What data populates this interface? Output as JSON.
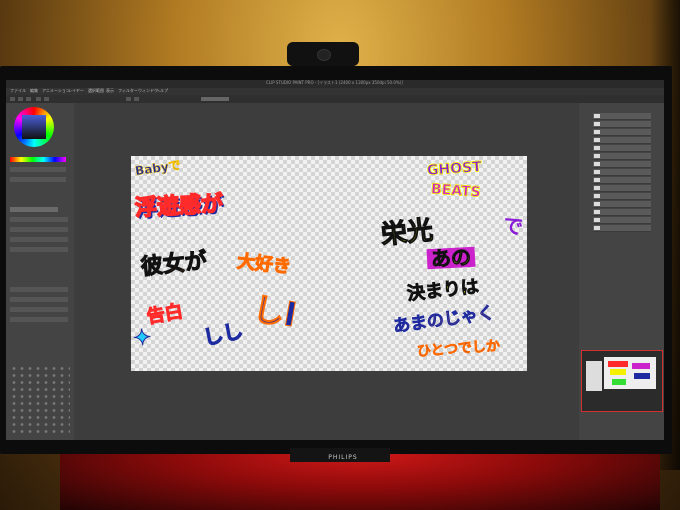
{
  "app": {
    "title": "CLIP STUDIO PAINT PRO - [イラスト1 (2400 x 1300px 350dpi 50.0%)]",
    "menu": [
      "ファイル",
      "編集",
      "アニメーション",
      "レイヤー",
      "選択範囲",
      "表示",
      "フィルター",
      "ウィンドウ",
      "ヘルプ"
    ]
  },
  "monitor": {
    "brand": "PHILIPS"
  },
  "artwork": {
    "top_left_text": "Babyで",
    "left_texts": [
      "浮遊感が",
      "彼女が",
      "大好き",
      "告白"
    ],
    "left_extra": "しし",
    "right_texts": [
      "GHOST",
      "BEATS",
      "で",
      "栄光",
      "あの",
      "決まりは",
      "あまのじゃく",
      "ひとつでしか"
    ],
    "colors": {
      "navy": "#1d2aa0",
      "orange": "#ff6a00",
      "yellow": "#f4f000",
      "red": "#ff2a2a",
      "pink": "#ff1a9a",
      "green": "#33dd33",
      "cyan": "#22ccff",
      "purple": "#8a1cd8",
      "lime": "#b8f000",
      "magenta": "#cc22cc"
    }
  },
  "icons": {
    "color_wheel": "color-wheel-icon",
    "layer_thumb": "layer-thumbnail-icon"
  }
}
